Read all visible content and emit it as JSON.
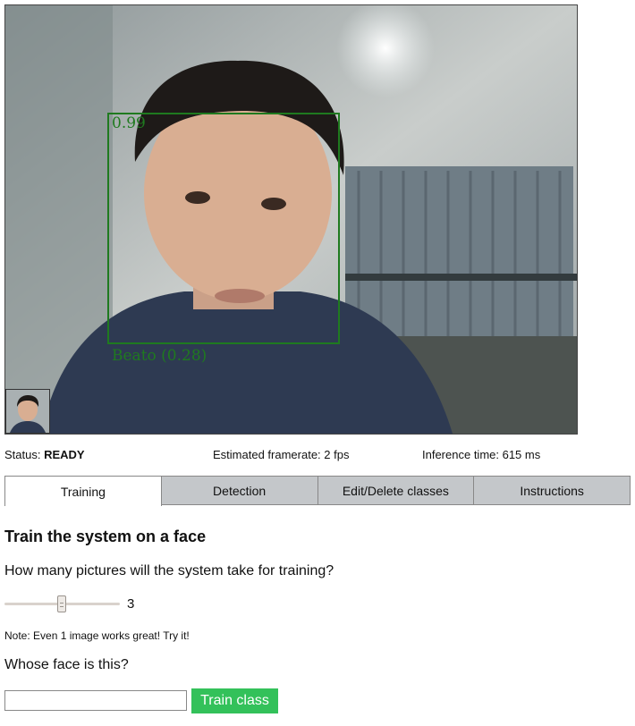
{
  "camera": {
    "confidence_label": "0.99",
    "prediction_label": "Beato (0.28)"
  },
  "status": {
    "label": "Status:",
    "value": "READY",
    "framerate": "Estimated framerate: 2 fps",
    "inference": "Inference time: 615 ms"
  },
  "tabs": [
    {
      "label": "Training",
      "active": true
    },
    {
      "label": "Detection",
      "active": false
    },
    {
      "label": "Edit/Delete classes",
      "active": false
    },
    {
      "label": "Instructions",
      "active": false
    }
  ],
  "training": {
    "heading": "Train the system on a face",
    "question_count": "How many pictures will the system take for training?",
    "slider_value": "3",
    "note": "Note: Even 1 image works great! Try it!",
    "question_name": "Whose face is this?",
    "name_value": "",
    "button_label": "Train class"
  },
  "colors": {
    "detection_box": "#1f7a1f",
    "train_button": "#33c15a",
    "tab_inactive": "#c4c7ca"
  }
}
